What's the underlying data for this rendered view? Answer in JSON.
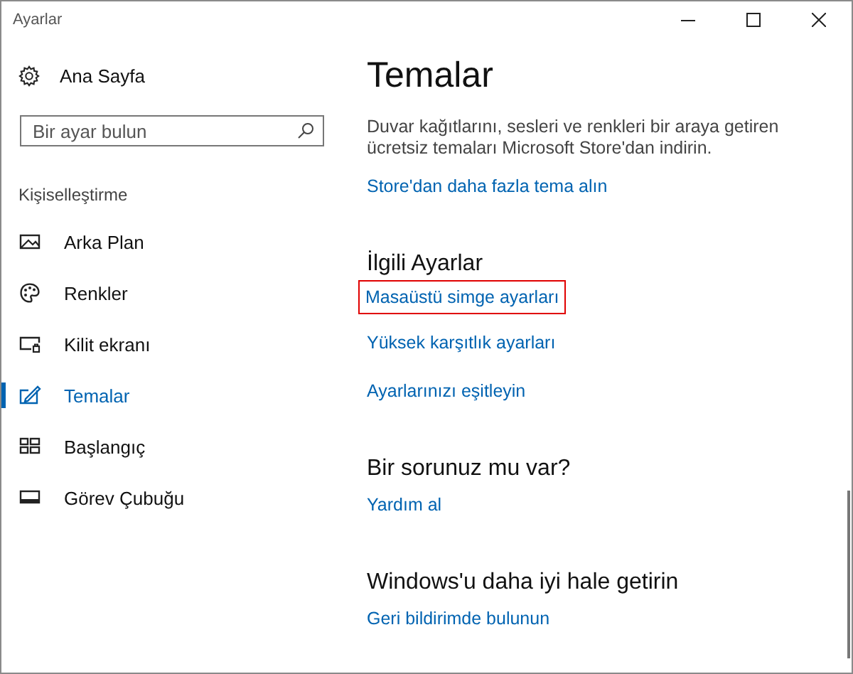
{
  "window": {
    "title": "Ayarlar"
  },
  "sidebar": {
    "home": "Ana Sayfa",
    "search": {
      "placeholder": "Bir ayar bulun"
    },
    "group": "Kişiselleştirme",
    "items": [
      {
        "label": "Arka Plan",
        "kind": "picture",
        "selected": false
      },
      {
        "label": "Renkler",
        "kind": "palette",
        "selected": false
      },
      {
        "label": "Kilit ekranı",
        "kind": "lockscreen",
        "selected": false
      },
      {
        "label": "Temalar",
        "kind": "themes",
        "selected": true
      },
      {
        "label": "Başlangıç",
        "kind": "start",
        "selected": false
      },
      {
        "label": "Görev Çubuğu",
        "kind": "taskbar",
        "selected": false
      }
    ]
  },
  "content": {
    "title": "Temalar",
    "description": "Duvar kağıtlarını, sesleri ve renkleri bir araya getiren ücretsiz temaları Microsoft Store'dan indirin.",
    "sections": [
      {
        "links": [
          {
            "label": "Store'dan daha fazla tema alın",
            "highlighted": false
          }
        ]
      },
      {
        "heading": "İlgili Ayarlar",
        "links": [
          {
            "label": "Masaüstü simge ayarları",
            "highlighted": true
          },
          {
            "label": "Yüksek karşıtlık ayarları",
            "highlighted": false
          },
          {
            "label": "Ayarlarınızı eşitleyin",
            "highlighted": false
          }
        ]
      },
      {
        "heading": "Bir sorunuz mu var?",
        "links": [
          {
            "label": "Yardım al",
            "highlighted": false
          }
        ]
      },
      {
        "heading": "Windows'u daha iyi hale getirin",
        "links": [
          {
            "label": "Geri bildirimde bulunun",
            "highlighted": false
          }
        ]
      }
    ]
  }
}
